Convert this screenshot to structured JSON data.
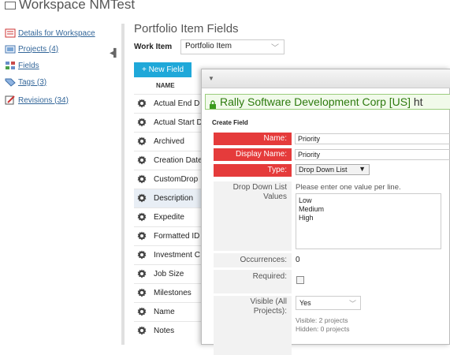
{
  "workspace": {
    "title": "Workspace NMTest"
  },
  "sidebar": {
    "items": [
      {
        "label": "Details for Workspace"
      },
      {
        "label": "Projects (4)"
      },
      {
        "label": "Fields"
      },
      {
        "label": "Tags (3)"
      },
      {
        "label": "Revisions (34)"
      }
    ]
  },
  "main": {
    "title": "Portfolio Item Fields",
    "work_item_label": "Work Item",
    "work_item_value": "Portfolio Item",
    "new_field_label": "+ New Field",
    "column_name": "NAME",
    "fields": [
      "Actual End D",
      "Actual Start D",
      "Archived",
      "Creation Date",
      "CustomDrop",
      "Description",
      "Expedite",
      "Formatted ID",
      "Investment C",
      "Job Size",
      "Milestones",
      "Name",
      "Notes"
    ],
    "selected_field": "Description"
  },
  "dialog": {
    "url_domain": "Rally Software Development Corp [US]",
    "url_rest": "ht",
    "heading": "Create Field",
    "name_label": "Name:",
    "name_value": "Priority",
    "display_name_label": "Display Name:",
    "display_name_value": "Priority",
    "type_label": "Type:",
    "type_value": "Drop Down List",
    "ddl_label": "Drop Down List Values",
    "ddl_help": "Please enter one value per line.",
    "ddl_values": [
      "Low",
      "Medium",
      "High"
    ],
    "occurrences_label": "Occurrences:",
    "occurrences_value": "0",
    "required_label": "Required:",
    "required_checked": false,
    "visible_label": "Visible (All Projects):",
    "visible_value": "Yes",
    "visible_count": "Visible: 2 projects",
    "hidden_count": "Hidden: 0 projects"
  },
  "colors": {
    "accent": "#1fa8d9",
    "required": "#e53b3b",
    "link": "#336699",
    "secure": "#2d7a0e"
  }
}
